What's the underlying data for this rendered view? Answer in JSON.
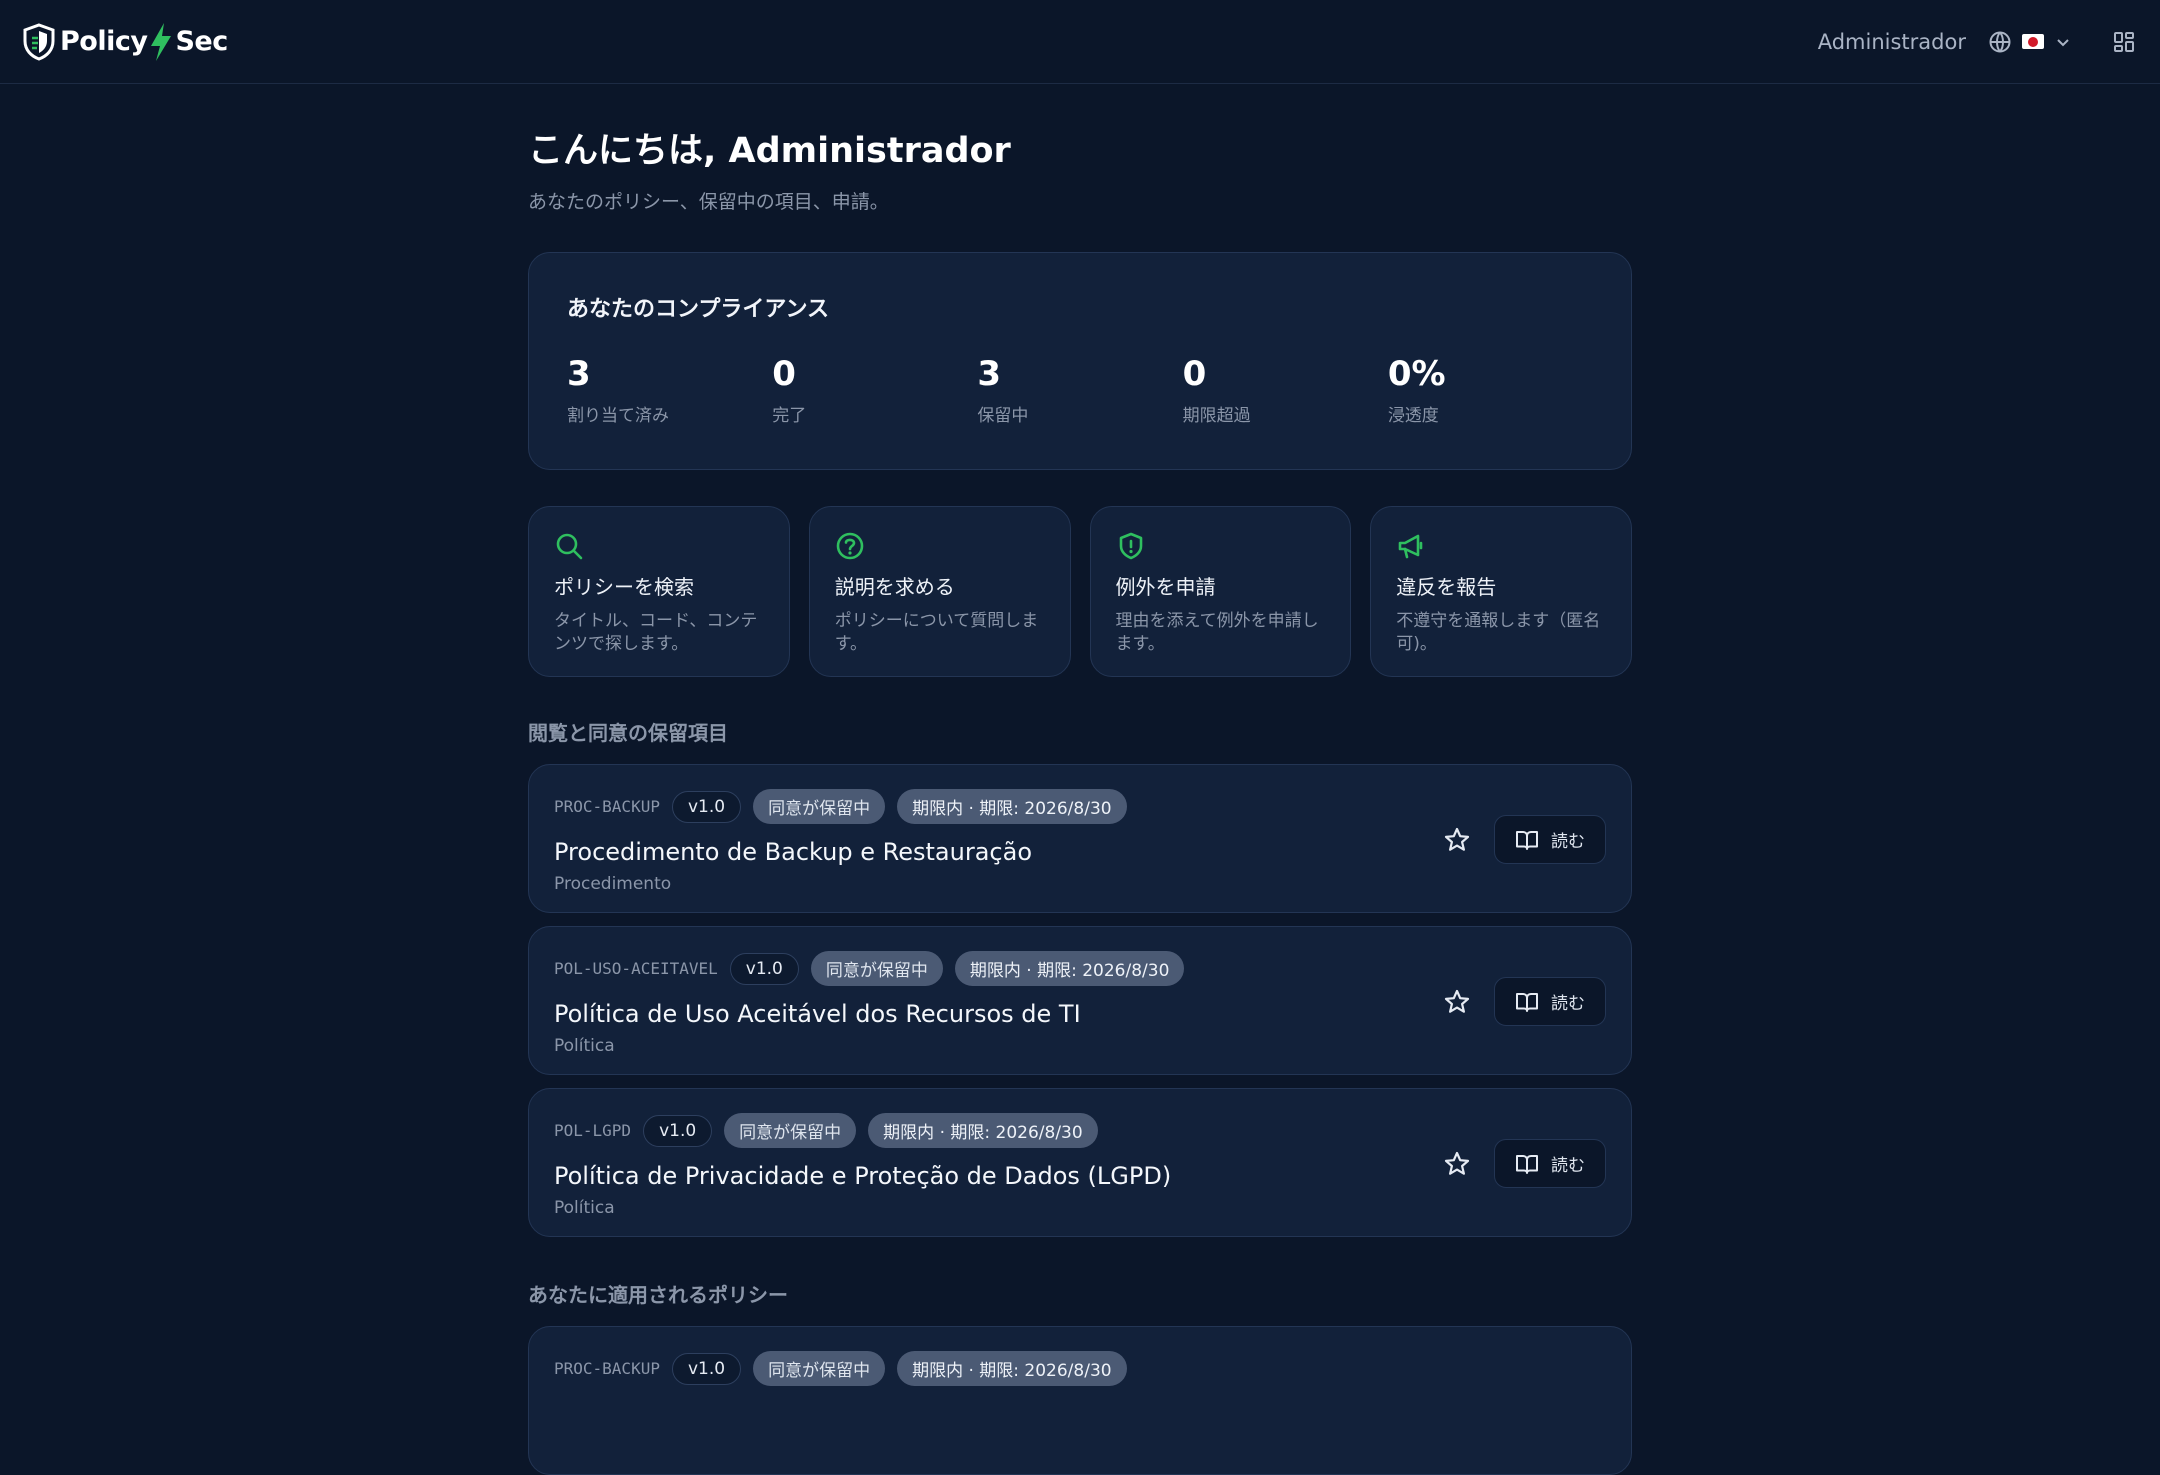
{
  "app": {
    "logo_left": "Policy",
    "logo_right": "Sec",
    "user_name": "Administrador",
    "lang_flag": "jp-flag"
  },
  "colors": {
    "background": "#0b1629",
    "card": "#12213a",
    "accent_green": "#2fbf5f",
    "pill_gray": "#4b5a74"
  },
  "greeting": {
    "title": "こんにちは, Administrador",
    "subtitle": "あなたのポリシー、保留中の項目、申請。"
  },
  "compliance": {
    "title": "あなたのコンプライアンス",
    "stats": [
      {
        "value": "3",
        "label": "割り当て済み"
      },
      {
        "value": "0",
        "label": "完了"
      },
      {
        "value": "3",
        "label": "保留中"
      },
      {
        "value": "0",
        "label": "期限超過"
      },
      {
        "value": "0%",
        "label": "浸透度"
      }
    ]
  },
  "actions": [
    {
      "icon": "search-icon",
      "title": "ポリシーを検索",
      "desc": "タイトル、コード、コンテンツで探します。"
    },
    {
      "icon": "help-circle-icon",
      "title": "説明を求める",
      "desc": "ポリシーについて質問します。"
    },
    {
      "icon": "shield-alert-icon",
      "title": "例外を申請",
      "desc": "理由を添えて例外を申請します。"
    },
    {
      "icon": "megaphone-icon",
      "title": "違反を報告",
      "desc": "不遵守を通報します（匿名可)。"
    }
  ],
  "pending": {
    "title": "閲覧と同意の保留項目",
    "items": [
      {
        "code": "PROC-BACKUP",
        "version": "v1.0",
        "status": "同意が保留中",
        "due": "期限内 · 期限: 2026/8/30",
        "title": "Procedimento de Backup e Restauração",
        "type": "Procedimento",
        "read_label": "読む"
      },
      {
        "code": "POL-USO-ACEITAVEL",
        "version": "v1.0",
        "status": "同意が保留中",
        "due": "期限内 · 期限: 2026/8/30",
        "title": "Política de Uso Aceitável dos Recursos de TI",
        "type": "Política",
        "read_label": "読む"
      },
      {
        "code": "POL-LGPD",
        "version": "v1.0",
        "status": "同意が保留中",
        "due": "期限内 · 期限: 2026/8/30",
        "title": "Política de Privacidade e Proteção de Dados (LGPD)",
        "type": "Política",
        "read_label": "読む"
      }
    ]
  },
  "applicable": {
    "title": "あなたに適用されるポリシー",
    "first": {
      "code": "PROC-BACKUP",
      "version": "v1.0",
      "status": "同意が保留中",
      "due": "期限内 · 期限: 2026/8/30"
    }
  }
}
